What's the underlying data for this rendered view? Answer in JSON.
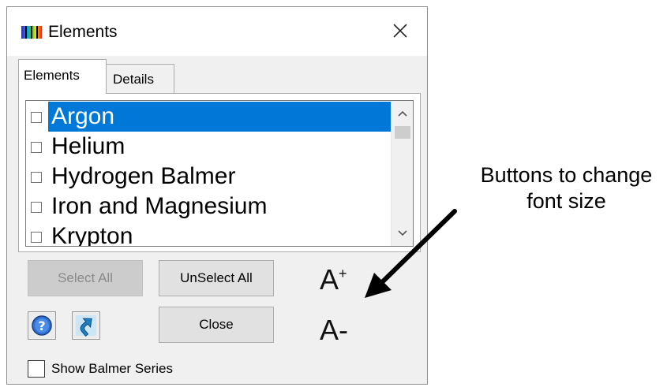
{
  "window": {
    "title": "Elements",
    "icon": "spectrum-icon",
    "close_icon": "close-icon"
  },
  "tabs": [
    {
      "label": "Elements",
      "active": true
    },
    {
      "label": "Details",
      "active": false
    }
  ],
  "list": {
    "items": [
      {
        "label": "Argon",
        "checked": false,
        "selected": true
      },
      {
        "label": "Helium",
        "checked": false,
        "selected": false
      },
      {
        "label": "Hydrogen Balmer",
        "checked": false,
        "selected": false
      },
      {
        "label": "Iron and Magnesium",
        "checked": false,
        "selected": false
      },
      {
        "label": "Krypton",
        "checked": false,
        "selected": false
      }
    ],
    "scroll_up_icon": "chevron-up-icon",
    "scroll_down_icon": "chevron-down-icon"
  },
  "buttons": {
    "select_all": "Select All",
    "unselect_all": "UnSelect All",
    "close": "Close",
    "font_increase": "A",
    "font_increase_sup": "+",
    "font_decrease": "A-"
  },
  "icons": {
    "help": "help-icon",
    "link": "arrow-link-icon"
  },
  "checkbox": {
    "label": "Show Balmer Series",
    "checked": false
  },
  "annotation": {
    "line1": "Buttons to change",
    "line2": "font size"
  },
  "colors": {
    "selection": "#0078d7",
    "disabled_button": "#cccccc"
  }
}
